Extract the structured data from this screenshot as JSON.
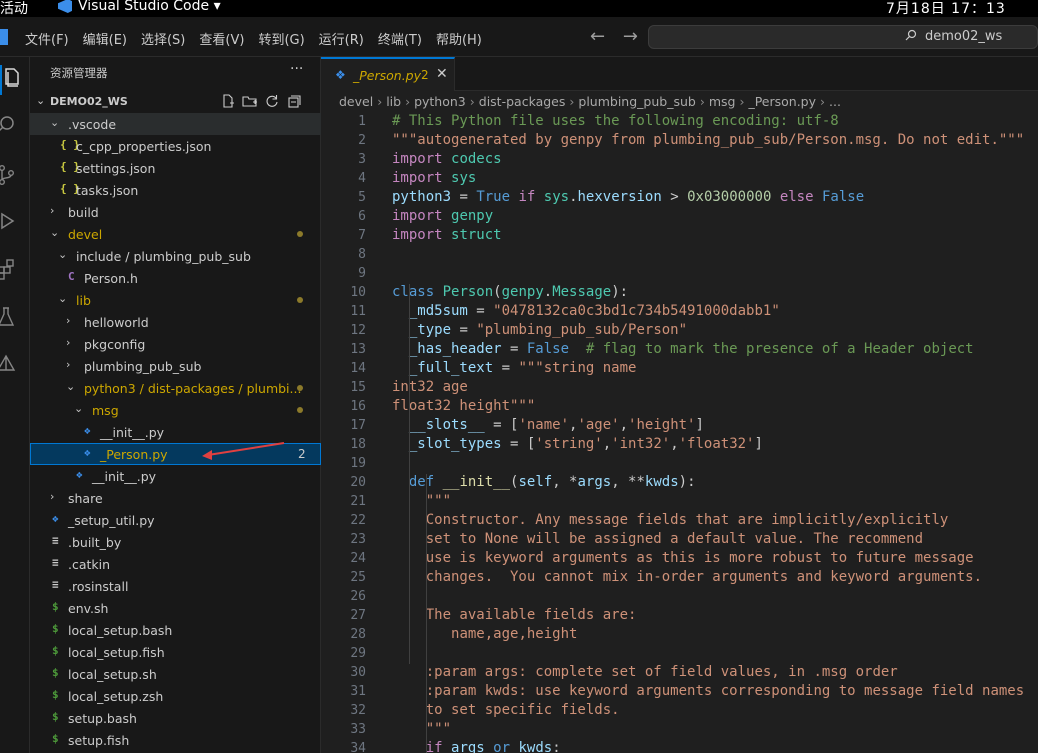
{
  "os_bar": {
    "activities": "活动",
    "app": "Visual Studio Code ▾",
    "clock": "7月18日  17：13"
  },
  "menu": [
    "文件(F)",
    "编辑(E)",
    "选择(S)",
    "查看(V)",
    "转到(G)",
    "运行(R)",
    "终端(T)",
    "帮助(H)"
  ],
  "nav": {
    "back": "←",
    "forward": "→"
  },
  "search": {
    "text": "demo02_ws"
  },
  "sidebar": {
    "title": "资源管理器",
    "more": "···",
    "workspace": "DEMO02_WS",
    "tree": [
      {
        "depth": 1,
        "type": "folder",
        "open": true,
        "label": ".vscode",
        "hl": true
      },
      {
        "depth": 2,
        "type": "json",
        "label": "c_cpp_properties.json"
      },
      {
        "depth": 2,
        "type": "json",
        "label": "settings.json"
      },
      {
        "depth": 2,
        "type": "json",
        "label": "tasks.json"
      },
      {
        "depth": 1,
        "type": "folder",
        "open": false,
        "label": "build"
      },
      {
        "depth": 1,
        "type": "folder",
        "open": true,
        "label": "devel",
        "yellow": true,
        "dot": true
      },
      {
        "depth": 2,
        "type": "folder",
        "open": true,
        "label": "include / plumbing_pub_sub"
      },
      {
        "depth": 3,
        "type": "c",
        "label": "Person.h"
      },
      {
        "depth": 2,
        "type": "folder",
        "open": true,
        "label": "lib",
        "yellow": true,
        "dot": true
      },
      {
        "depth": 3,
        "type": "folder",
        "open": false,
        "label": "helloworld"
      },
      {
        "depth": 3,
        "type": "folder",
        "open": false,
        "label": "pkgconfig"
      },
      {
        "depth": 3,
        "type": "folder",
        "open": false,
        "label": "plumbing_pub_sub"
      },
      {
        "depth": 3,
        "type": "folder",
        "open": true,
        "label": "python3 / dist-packages / plumbi...",
        "yellow": true,
        "dot": true
      },
      {
        "depth": 4,
        "type": "folder",
        "open": true,
        "label": "msg",
        "yellow": true,
        "dot": true
      },
      {
        "depth": 5,
        "type": "py",
        "label": "__init__.py"
      },
      {
        "depth": 5,
        "type": "py",
        "label": "_Person.py",
        "yellow": true,
        "badge": "2",
        "selected": true
      },
      {
        "depth": 4,
        "type": "py",
        "label": "__init__.py"
      },
      {
        "depth": 1,
        "type": "folder",
        "open": false,
        "label": "share"
      },
      {
        "depth": 1,
        "type": "py",
        "label": "_setup_util.py"
      },
      {
        "depth": 1,
        "type": "txt",
        "label": ".built_by"
      },
      {
        "depth": 1,
        "type": "txt",
        "label": ".catkin"
      },
      {
        "depth": 1,
        "type": "txt",
        "label": ".rosinstall"
      },
      {
        "depth": 1,
        "type": "sh",
        "label": "env.sh"
      },
      {
        "depth": 1,
        "type": "sh",
        "label": "local_setup.bash"
      },
      {
        "depth": 1,
        "type": "sh",
        "label": "local_setup.fish"
      },
      {
        "depth": 1,
        "type": "sh",
        "label": "local_setup.sh"
      },
      {
        "depth": 1,
        "type": "sh",
        "label": "local_setup.zsh"
      },
      {
        "depth": 1,
        "type": "sh",
        "label": "setup.bash"
      },
      {
        "depth": 1,
        "type": "sh",
        "label": "setup.fish"
      }
    ]
  },
  "tab": {
    "name": "_Person.py",
    "count": "2",
    "close": "✕"
  },
  "breadcrumb": [
    "devel",
    "lib",
    "python3",
    "dist-packages",
    "plumbing_pub_sub",
    "msg",
    "_Person.py",
    "..."
  ],
  "code": [
    [
      [
        "c",
        "# This Python file uses the following encoding: utf-8"
      ]
    ],
    [
      [
        "s",
        "\"\"\"autogenerated by genpy from plumbing_pub_sub/Person.msg. Do not edit.\"\"\""
      ]
    ],
    [
      [
        "kc",
        "import"
      ],
      [
        "",
        " "
      ],
      [
        "cls",
        "codecs"
      ]
    ],
    [
      [
        "kc",
        "import"
      ],
      [
        "",
        " "
      ],
      [
        "cls",
        "sys"
      ]
    ],
    [
      [
        "v",
        "python3"
      ],
      [
        "",
        " = "
      ],
      [
        "k",
        "True"
      ],
      [
        "",
        " "
      ],
      [
        "kc",
        "if"
      ],
      [
        "",
        " "
      ],
      [
        "cls",
        "sys"
      ],
      [
        "",
        "."
      ],
      [
        "v",
        "hexversion"
      ],
      [
        "",
        " > "
      ],
      [
        "n",
        "0x03000000"
      ],
      [
        "",
        " "
      ],
      [
        "kc",
        "else"
      ],
      [
        "",
        " "
      ],
      [
        "k",
        "False"
      ]
    ],
    [
      [
        "kc",
        "import"
      ],
      [
        "",
        " "
      ],
      [
        "cls",
        "genpy"
      ]
    ],
    [
      [
        "kc",
        "import"
      ],
      [
        "",
        " "
      ],
      [
        "cls",
        "struct"
      ]
    ],
    [],
    [],
    [
      [
        "k",
        "class"
      ],
      [
        "",
        " "
      ],
      [
        "cls",
        "Person"
      ],
      [
        "",
        "("
      ],
      [
        "cls",
        "genpy"
      ],
      [
        "",
        "."
      ],
      [
        "cls",
        "Message"
      ],
      [
        "",
        "):"
      ]
    ],
    [
      [
        "",
        "  "
      ],
      [
        "v",
        "_md5sum"
      ],
      [
        "",
        " = "
      ],
      [
        "s",
        "\"0478132ca0c3bd1c734b5491000dabb1\""
      ]
    ],
    [
      [
        "",
        "  "
      ],
      [
        "v",
        "_type"
      ],
      [
        "",
        " = "
      ],
      [
        "s",
        "\"plumbing_pub_sub/Person\""
      ]
    ],
    [
      [
        "",
        "  "
      ],
      [
        "v",
        "_has_header"
      ],
      [
        "",
        " = "
      ],
      [
        "k",
        "False"
      ],
      [
        "",
        "  "
      ],
      [
        "c",
        "# flag to mark the presence of a Header object"
      ]
    ],
    [
      [
        "",
        "  "
      ],
      [
        "v",
        "_full_text"
      ],
      [
        "",
        " = "
      ],
      [
        "s",
        "\"\"\"string name"
      ]
    ],
    [
      [
        "s",
        "int32 age"
      ]
    ],
    [
      [
        "s",
        "float32 height\"\"\""
      ]
    ],
    [
      [
        "",
        "  "
      ],
      [
        "v",
        "__slots__"
      ],
      [
        "",
        " = ["
      ],
      [
        "s",
        "'name'"
      ],
      [
        "",
        ","
      ],
      [
        "s",
        "'age'"
      ],
      [
        "",
        ","
      ],
      [
        "s",
        "'height'"
      ],
      [
        "",
        "]"
      ]
    ],
    [
      [
        "",
        "  "
      ],
      [
        "v",
        "_slot_types"
      ],
      [
        "",
        " = ["
      ],
      [
        "s",
        "'string'"
      ],
      [
        "",
        ","
      ],
      [
        "s",
        "'int32'"
      ],
      [
        "",
        ","
      ],
      [
        "s",
        "'float32'"
      ],
      [
        "",
        "]"
      ]
    ],
    [],
    [
      [
        "",
        "  "
      ],
      [
        "k",
        "def"
      ],
      [
        "",
        " "
      ],
      [
        "fn",
        "__init__"
      ],
      [
        "",
        "("
      ],
      [
        "v",
        "self"
      ],
      [
        "",
        ", *"
      ],
      [
        "v",
        "args"
      ],
      [
        "",
        ", **"
      ],
      [
        "v",
        "kwds"
      ],
      [
        "",
        "):"
      ]
    ],
    [
      [
        "",
        "    "
      ],
      [
        "s",
        "\"\"\""
      ]
    ],
    [
      [
        "",
        "    "
      ],
      [
        "s",
        "Constructor. Any message fields that are implicitly/explicitly"
      ]
    ],
    [
      [
        "",
        "    "
      ],
      [
        "s",
        "set to None will be assigned a default value. The recommend"
      ]
    ],
    [
      [
        "",
        "    "
      ],
      [
        "s",
        "use is keyword arguments as this is more robust to future message"
      ]
    ],
    [
      [
        "",
        "    "
      ],
      [
        "s",
        "changes.  You cannot mix in-order arguments and keyword arguments."
      ]
    ],
    [],
    [
      [
        "",
        "    "
      ],
      [
        "s",
        "The available fields are:"
      ]
    ],
    [
      [
        "",
        "       "
      ],
      [
        "s",
        "name,age,height"
      ]
    ],
    [],
    [
      [
        "",
        "    "
      ],
      [
        "s",
        ":param args: complete set of field values, in .msg order"
      ]
    ],
    [
      [
        "",
        "    "
      ],
      [
        "s",
        ":param kwds: use keyword arguments corresponding to message field names"
      ]
    ],
    [
      [
        "",
        "    "
      ],
      [
        "s",
        "to set specific fields."
      ]
    ],
    [
      [
        "",
        "    "
      ],
      [
        "s",
        "\"\"\""
      ]
    ],
    [
      [
        "",
        "    "
      ],
      [
        "kc",
        "if"
      ],
      [
        "",
        " "
      ],
      [
        "v",
        "args"
      ],
      [
        "",
        " "
      ],
      [
        "k",
        "or"
      ],
      [
        "",
        " "
      ],
      [
        "v",
        "kwds"
      ],
      [
        "",
        ":"
      ]
    ]
  ]
}
